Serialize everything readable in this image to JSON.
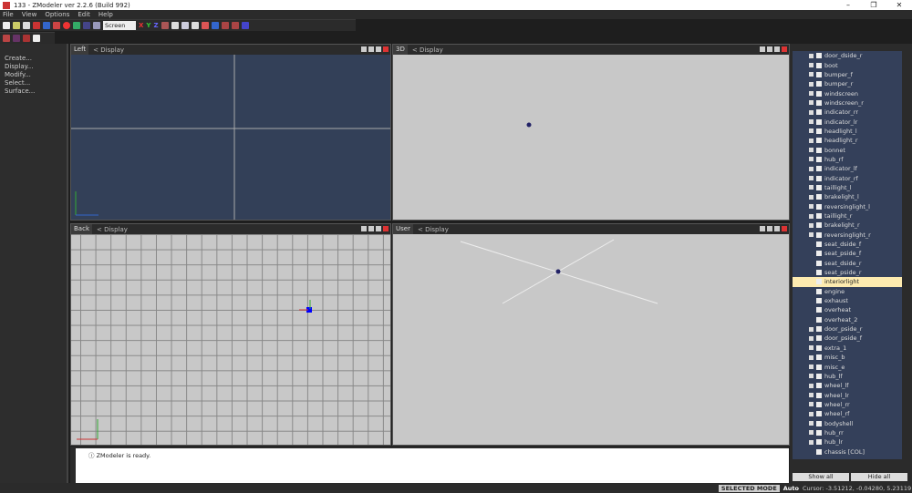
{
  "window": {
    "title": "133 - ZModeler ver 2.2.6 (Build 992)"
  },
  "menu": [
    "File",
    "View",
    "Options",
    "Edit",
    "Help"
  ],
  "toolbar": {
    "view_select": "Screen",
    "axis_x": "X",
    "axis_y": "Y",
    "axis_z": "Z"
  },
  "left_panel": [
    "Create...",
    "Display...",
    "Modify...",
    "Select...",
    "Surface..."
  ],
  "viewports": [
    {
      "name": "Left",
      "mode": "Display"
    },
    {
      "name": "3D",
      "mode": "Display"
    },
    {
      "name": "Back",
      "mode": "Display"
    },
    {
      "name": "User",
      "mode": "Display"
    }
  ],
  "tree": {
    "items": [
      {
        "label": "door_dside_r",
        "expand": true
      },
      {
        "label": "boot",
        "expand": true
      },
      {
        "label": "bumper_f",
        "expand": true
      },
      {
        "label": "bumper_r",
        "expand": true
      },
      {
        "label": "windscreen",
        "expand": true
      },
      {
        "label": "windscreen_r",
        "expand": true
      },
      {
        "label": "indicator_rr",
        "expand": true
      },
      {
        "label": "indicator_lr",
        "expand": true
      },
      {
        "label": "headlight_l",
        "expand": true
      },
      {
        "label": "headlight_r",
        "expand": true
      },
      {
        "label": "bonnet",
        "expand": true
      },
      {
        "label": "hub_rf",
        "expand": true
      },
      {
        "label": "indicator_lf",
        "expand": true
      },
      {
        "label": "indicator_rf",
        "expand": true
      },
      {
        "label": "taillight_l",
        "expand": true
      },
      {
        "label": "brakelight_l",
        "expand": true
      },
      {
        "label": "reversinglight_l",
        "expand": true
      },
      {
        "label": "taillight_r",
        "expand": true
      },
      {
        "label": "brakelight_r",
        "expand": true
      },
      {
        "label": "reversinglight_r",
        "expand": true
      },
      {
        "label": "seat_dside_f",
        "expand": false
      },
      {
        "label": "seat_pside_f",
        "expand": false
      },
      {
        "label": "seat_dside_r",
        "expand": false
      },
      {
        "label": "seat_pside_r",
        "expand": false
      },
      {
        "label": "interiorlight",
        "expand": false,
        "selected": true
      },
      {
        "label": "engine",
        "expand": false
      },
      {
        "label": "exhaust",
        "expand": false
      },
      {
        "label": "overheat",
        "expand": false
      },
      {
        "label": "overheat_2",
        "expand": false
      },
      {
        "label": "door_pside_r",
        "expand": true
      },
      {
        "label": "door_pside_f",
        "expand": true
      },
      {
        "label": "extra_1",
        "expand": true
      },
      {
        "label": "misc_b",
        "expand": true
      },
      {
        "label": "misc_e",
        "expand": true
      },
      {
        "label": "hub_lf",
        "expand": true
      },
      {
        "label": "wheel_lf",
        "expand": true
      },
      {
        "label": "wheel_lr",
        "expand": true
      },
      {
        "label": "wheel_rr",
        "expand": true
      },
      {
        "label": "wheel_rf",
        "expand": true
      },
      {
        "label": "bodyshell",
        "expand": true
      },
      {
        "label": "hub_rr",
        "expand": true
      },
      {
        "label": "hub_lr",
        "expand": true
      },
      {
        "label": "chassis [COL]",
        "expand": false
      }
    ],
    "show_all": "Show all",
    "hide_all": "Hide all"
  },
  "log": {
    "message": "ZModeler is ready."
  },
  "status": {
    "mode": "SELECTED MODE",
    "auto": "Auto",
    "cursor": "Cursor: -3.51212, -0.04280, 5.23119"
  },
  "colors": {
    "ortho_bg": "#334058",
    "persp_bg": "#c8c8c8",
    "selection": "#fdebb0"
  }
}
